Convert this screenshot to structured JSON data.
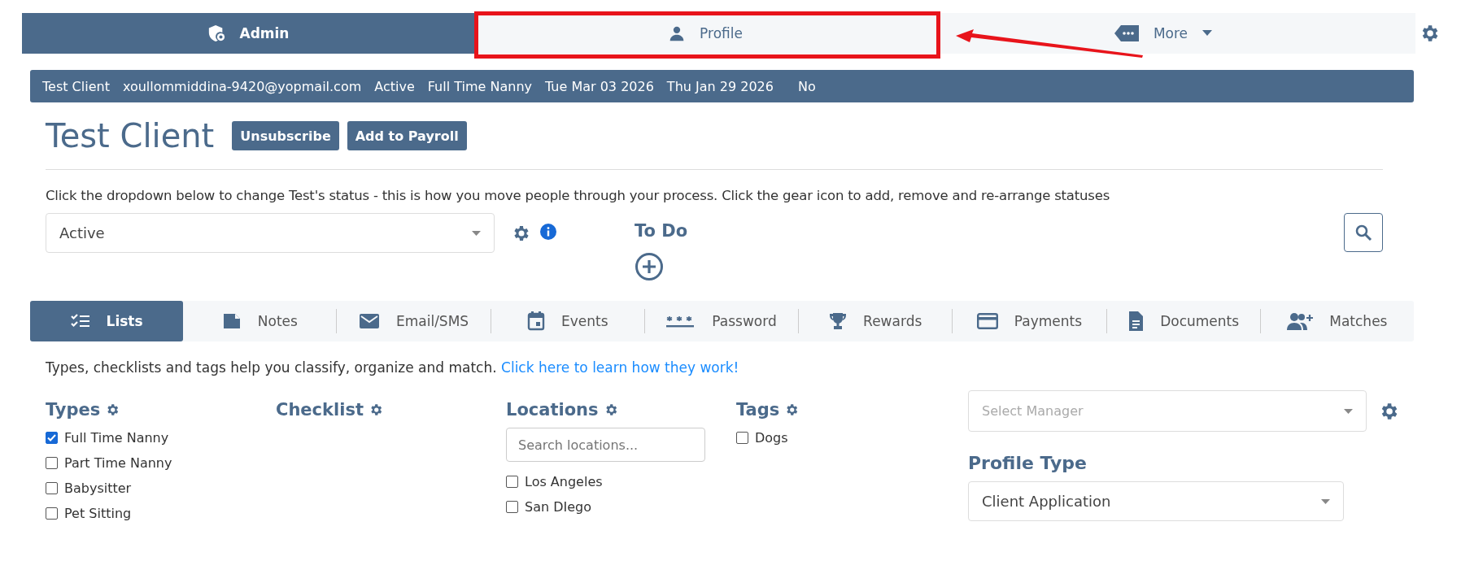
{
  "nav": [
    {
      "label": "Admin",
      "kind": "tab",
      "selected": true,
      "highlighted": false
    },
    {
      "label": "Profile",
      "kind": "tab",
      "selected": false,
      "highlighted": true
    },
    {
      "label": "More",
      "kind": "menu",
      "selected": false,
      "highlighted": false
    }
  ],
  "info_bar": [
    "Test Client",
    "xoullommiddina-9420@yopmail.com",
    "Active",
    "Full Time Nanny",
    "Tue Mar 03 2026",
    "Thu Jan 29 2026",
    "No"
  ],
  "title": "Test Client",
  "title_buttons": [
    "Unsubscribe",
    "Add to Payroll"
  ],
  "status_hint": "Click the dropdown below to change Test's status - this is how you move people through your process. Click the gear icon to add, remove and re-arrange statuses",
  "status_select": {
    "value": "Active"
  },
  "todo": {
    "heading": "To Do"
  },
  "tabs": [
    {
      "label": "Lists",
      "selected": true
    },
    {
      "label": "Notes",
      "selected": false
    },
    {
      "label": "Email/SMS",
      "selected": false
    },
    {
      "label": "Events",
      "selected": false
    },
    {
      "label": "Password",
      "selected": false
    },
    {
      "label": "Rewards",
      "selected": false
    },
    {
      "label": "Payments",
      "selected": false
    },
    {
      "label": "Documents",
      "selected": false
    },
    {
      "label": "Matches",
      "selected": false
    }
  ],
  "intro": {
    "text": "Types, checklists and tags help you classify, organize and match.",
    "link": "Click here to learn how they work!"
  },
  "groups": [
    {
      "heading": "Types",
      "items": [
        {
          "label": "Full Time Nanny",
          "checked": true
        },
        {
          "label": "Part Time Nanny",
          "checked": false
        },
        {
          "label": "Babysitter",
          "checked": false
        },
        {
          "label": "Pet Sitting",
          "checked": false
        }
      ]
    },
    {
      "heading": "Checklist"
    },
    {
      "heading": "Locations",
      "search": {
        "placeholder": "Search locations..."
      },
      "items": [
        {
          "label": "Los Angeles",
          "checked": false
        },
        {
          "label": "San DIego",
          "checked": false
        }
      ]
    },
    {
      "heading": "Tags",
      "items": [
        {
          "label": "Dogs",
          "checked": false
        }
      ]
    }
  ],
  "manager_select": {
    "placeholder": "Select Manager"
  },
  "profile_type": {
    "heading": "Profile Type",
    "value": "Client Application"
  }
}
